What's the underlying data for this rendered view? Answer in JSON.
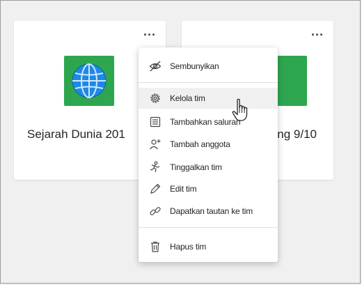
{
  "cards": [
    {
      "name": "Sejarah Dunia 201",
      "more_label": "..."
    },
    {
      "name": "ng 9/10",
      "more_label": "..."
    }
  ],
  "menu": {
    "items": [
      {
        "label": "Sembunyikan",
        "icon": "eye-off-icon"
      },
      {
        "label": "Kelola tim",
        "icon": "gear-icon"
      },
      {
        "label": "Tambahkan saluran",
        "icon": "channel-icon"
      },
      {
        "label": "Tambah anggota",
        "icon": "add-person-icon"
      },
      {
        "label": "Tinggalkan tim",
        "icon": "leave-icon"
      },
      {
        "label": "Edit tim",
        "icon": "pencil-icon"
      },
      {
        "label": "Dapatkan tautan ke tim",
        "icon": "link-icon"
      },
      {
        "label": "Hapus tim",
        "icon": "trash-icon"
      }
    ]
  },
  "colors": {
    "tile_green": "#2ea64f",
    "globe_blue": "#1e88e5"
  }
}
